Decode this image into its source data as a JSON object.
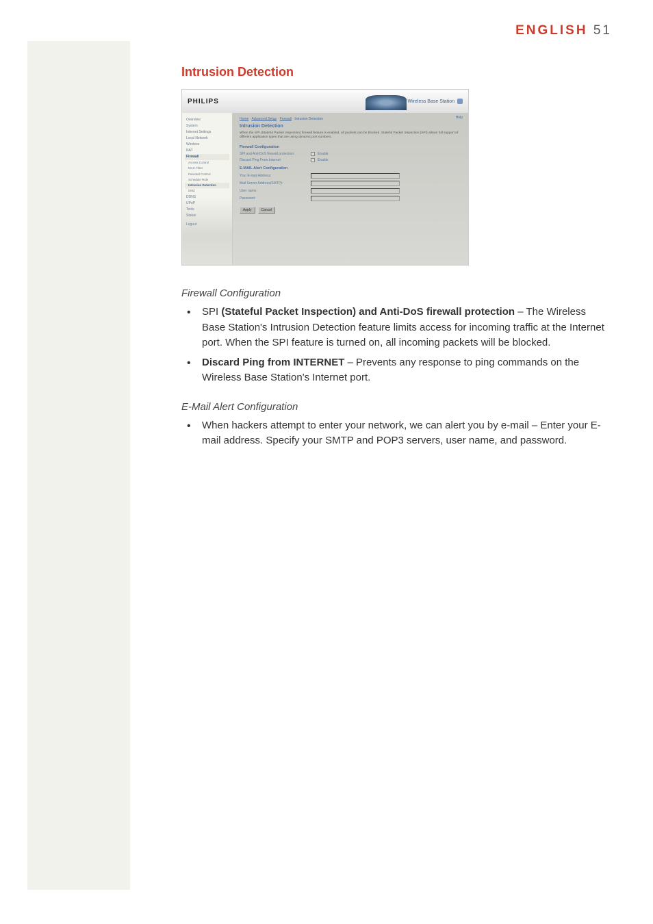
{
  "header": {
    "language": "ENGLISH",
    "page_number": "51"
  },
  "section_title": "Intrusion Detection",
  "screenshot": {
    "brand": "PHILIPS",
    "product_label": "Wireless Base Station",
    "sidebar": {
      "items": [
        "Overview",
        "System",
        "Internet Settings",
        "Local Network",
        "Wireless",
        "NAT"
      ],
      "firewall_label": "Firewall",
      "firewall_sub": [
        "Access Control",
        "MAC Filter",
        "Parental Control",
        "Schedule Rule",
        "Intrusion Detection",
        "DMZ"
      ],
      "after": [
        "DDNS",
        "UPnP",
        "Tools",
        "Status"
      ],
      "logout": "Logout"
    },
    "breadcrumb": {
      "home": "Home",
      "adv": "Advanced Setup",
      "fw": "Firewall",
      "cur": "Intrusion Detection"
    },
    "help": "Help",
    "main_title": "Intrusion Detection",
    "description": "When the SPI (Stateful Packet Inspection) firewall feature is enabled, all packets can be blocked. Stateful Packet Inspection (SPI) allows full support of different application types that are using dynamic port numbers.",
    "fw_section": "Firewall Configuration",
    "row_spi": {
      "label": "SPI and Anti-DoS firewall protection:",
      "option": "Enable"
    },
    "row_ping": {
      "label": "Discard Ping From Internet:",
      "option": "Enable"
    },
    "email_section": "E-MAIL Alert Configuration",
    "row_email": "Your E-mail Address:",
    "row_smtp": "Mail Server Address(SMTP):",
    "row_user": "User name:",
    "row_pass": "Password:",
    "btn_apply": "Apply",
    "btn_cancel": "Cancel"
  },
  "firewall_config_heading": "Firewall Configuration",
  "bullet_spi": {
    "lead": "SPI ",
    "bold": "(Stateful Packet Inspection) and Anti-DoS firewall protection",
    "rest": " – The Wireless Base Station's Intrusion Detection feature limits access for incoming traffic at the Internet port. When the SPI feature is turned on, all incoming packets will be blocked."
  },
  "bullet_ping": {
    "bold": "Discard Ping from INTERNET",
    "rest": " – Prevents any response to ping commands on the Wireless Base Station's Internet port."
  },
  "email_config_heading": "E-Mail Alert Configuration",
  "bullet_email": "When hackers attempt to enter your network, we can alert you by e-mail – Enter your E-mail address. Specify your SMTP and POP3 servers, user name, and password."
}
